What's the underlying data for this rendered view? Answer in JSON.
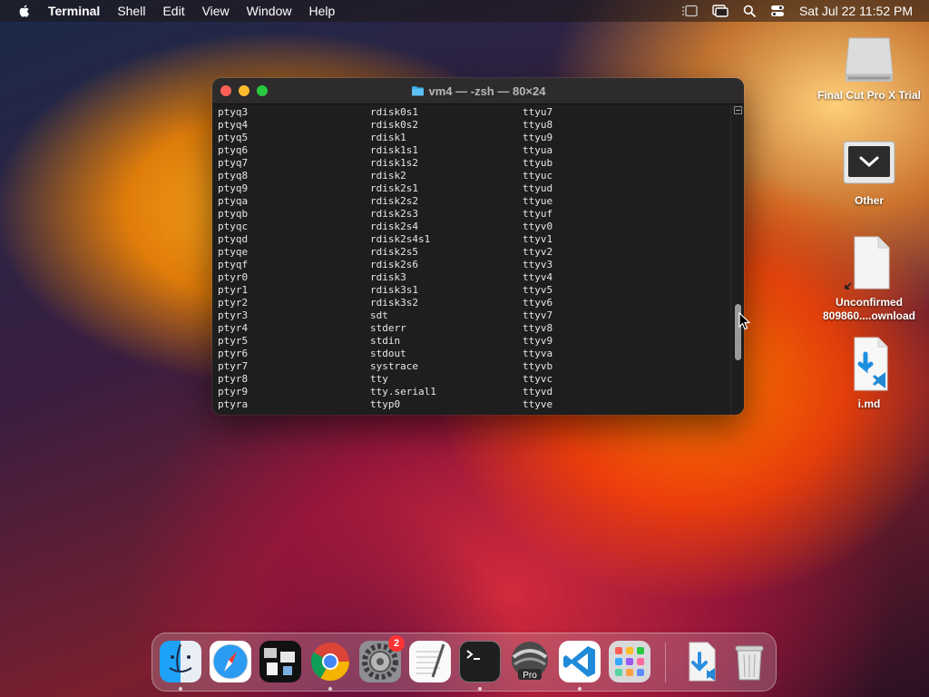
{
  "menubar": {
    "app_name": "Terminal",
    "items": [
      "Shell",
      "Edit",
      "View",
      "Window",
      "Help"
    ],
    "clock": "Sat Jul 22  11:52 PM"
  },
  "window": {
    "title": "vm4 — -zsh — 80×24",
    "lines": [
      [
        "ptyq3",
        "rdisk0s1",
        "ttyu7"
      ],
      [
        "ptyq4",
        "rdisk0s2",
        "ttyu8"
      ],
      [
        "ptyq5",
        "rdisk1",
        "ttyu9"
      ],
      [
        "ptyq6",
        "rdisk1s1",
        "ttyua"
      ],
      [
        "ptyq7",
        "rdisk1s2",
        "ttyub"
      ],
      [
        "ptyq8",
        "rdisk2",
        "ttyuc"
      ],
      [
        "ptyq9",
        "rdisk2s1",
        "ttyud"
      ],
      [
        "ptyqa",
        "rdisk2s2",
        "ttyue"
      ],
      [
        "ptyqb",
        "rdisk2s3",
        "ttyuf"
      ],
      [
        "ptyqc",
        "rdisk2s4",
        "ttyv0"
      ],
      [
        "ptyqd",
        "rdisk2s4s1",
        "ttyv1"
      ],
      [
        "ptyqe",
        "rdisk2s5",
        "ttyv2"
      ],
      [
        "ptyqf",
        "rdisk2s6",
        "ttyv3"
      ],
      [
        "ptyr0",
        "rdisk3",
        "ttyv4"
      ],
      [
        "ptyr1",
        "rdisk3s1",
        "ttyv5"
      ],
      [
        "ptyr2",
        "rdisk3s2",
        "ttyv6"
      ],
      [
        "ptyr3",
        "sdt",
        "ttyv7"
      ],
      [
        "ptyr4",
        "stderr",
        "ttyv8"
      ],
      [
        "ptyr5",
        "stdin",
        "ttyv9"
      ],
      [
        "ptyr6",
        "stdout",
        "ttyva"
      ],
      [
        "ptyr7",
        "systrace",
        "ttyvb"
      ],
      [
        "ptyr8",
        "tty",
        "ttyvc"
      ],
      [
        "ptyr9",
        "tty.serial1",
        "ttyvd"
      ],
      [
        "ptyra",
        "ttyp0",
        "ttyve"
      ]
    ]
  },
  "desktop": {
    "icons": [
      {
        "label": "Final Cut Pro X Trial",
        "icon": "drive-icon"
      },
      {
        "label": "Other",
        "icon": "folder-screen-icon"
      },
      {
        "label": "Unconfirmed 809860....ownload",
        "icon": "document-alias-icon"
      },
      {
        "label": "i.md",
        "icon": "vscode-document-icon"
      }
    ]
  },
  "dock": {
    "apps": [
      {
        "name": "finder-icon"
      },
      {
        "name": "safari-icon"
      },
      {
        "name": "mission-control-icon"
      },
      {
        "name": "chrome-icon"
      },
      {
        "name": "system-preferences-icon",
        "badge": "2"
      },
      {
        "name": "textedit-icon"
      },
      {
        "name": "terminal-icon"
      },
      {
        "name": "final-cut-pro-icon"
      },
      {
        "name": "vscode-icon"
      },
      {
        "name": "launchpad-icon"
      },
      {
        "name": "downloads-stack-icon"
      },
      {
        "name": "trash-icon"
      }
    ]
  }
}
